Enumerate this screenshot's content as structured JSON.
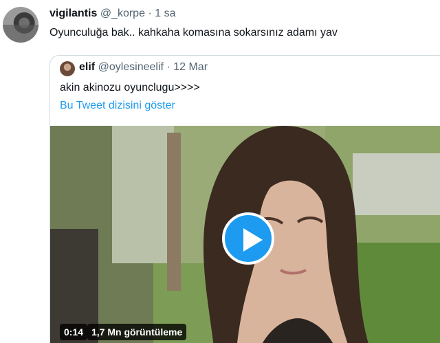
{
  "tweet": {
    "author_name": "vigilantis",
    "handle": "@_korpe",
    "separator": "·",
    "time": "1 sa",
    "text": "Oyunculuğa bak.. kahkaha komasına sokarsınız adamı yav"
  },
  "quoted_tweet": {
    "author_name": "elif",
    "handle": "@oylesineelif",
    "separator": "·",
    "date": "12 Mar",
    "text": "akin akinozu oyunclugu>>>>",
    "thread_link": "Bu Tweet dizisini göster",
    "video": {
      "duration": "0:14",
      "views": "1,7 Mn görüntüleme"
    }
  },
  "colors": {
    "link": "#1d9bf0",
    "secondary_text": "#536471",
    "border": "#cfd9de",
    "play_button": "#1d9bf0"
  },
  "icons": [
    "play-icon"
  ]
}
